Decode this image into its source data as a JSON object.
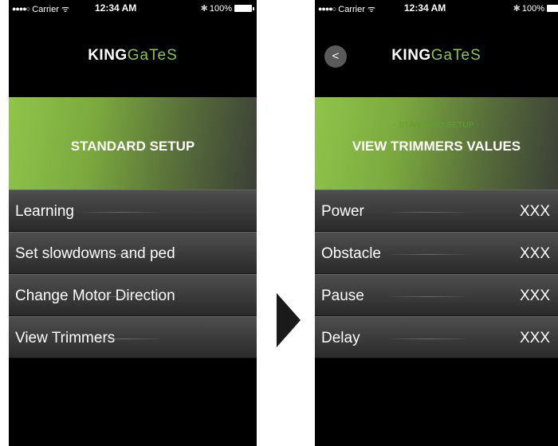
{
  "status": {
    "carrier": "Carrier",
    "time": "12:34 AM",
    "battery": "100%"
  },
  "logo": {
    "part1": "KING",
    "part2": "GaTeS"
  },
  "left_screen": {
    "banner_title": "STANDARD SETUP",
    "menu": [
      {
        "label": "Learning"
      },
      {
        "label": "Set slowdowns and ped"
      },
      {
        "label": "Change Motor Direction"
      },
      {
        "label": "View Trimmers"
      }
    ]
  },
  "right_screen": {
    "banner_subtitle": "- STANDARD SETUP -",
    "banner_title": "VIEW TRIMMERS VALUES",
    "rows": [
      {
        "label": "Power",
        "value": "XXX"
      },
      {
        "label": "Obstacle",
        "value": "XXX"
      },
      {
        "label": "Pause",
        "value": "XXX"
      },
      {
        "label": "Delay",
        "value": "XXX"
      }
    ]
  },
  "colors": {
    "accent": "#8dc63f",
    "background": "#000000"
  }
}
